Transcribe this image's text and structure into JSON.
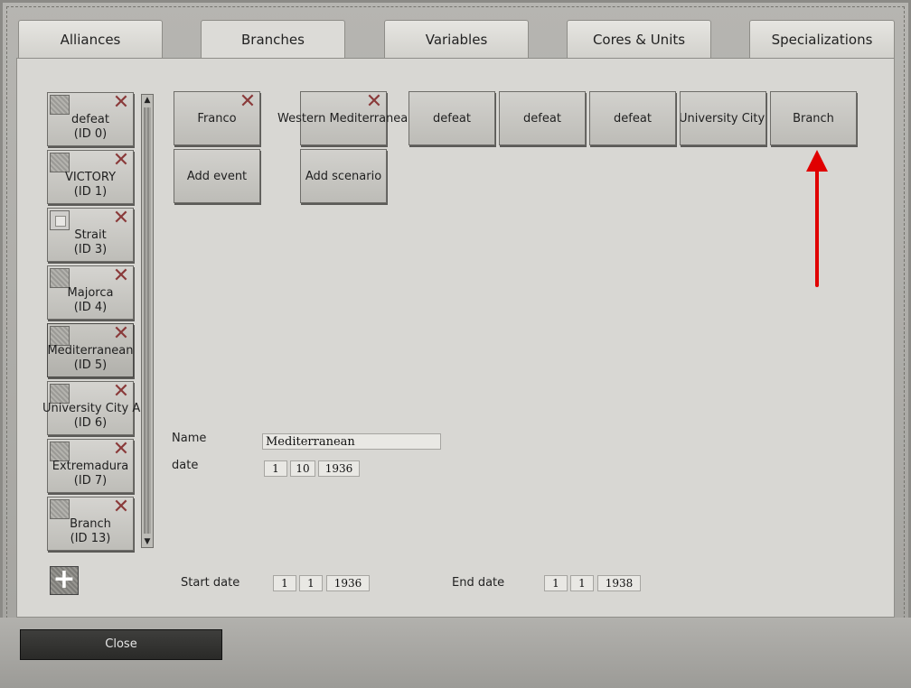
{
  "tabs": [
    {
      "label": "Alliances"
    },
    {
      "label": "Branches"
    },
    {
      "label": "Variables"
    },
    {
      "label": "Cores & Units"
    },
    {
      "label": "Specializations"
    }
  ],
  "sidebar": {
    "items": [
      {
        "label": "defeat",
        "id": "(ID 0)"
      },
      {
        "label": "VICTORY",
        "id": "(ID 1)"
      },
      {
        "label": "Strait",
        "id": "(ID 3)"
      },
      {
        "label": "Majorca",
        "id": "(ID 4)"
      },
      {
        "label": "Mediterranean",
        "id": "(ID 5)"
      },
      {
        "label": "University City A",
        "id": "(ID 6)"
      },
      {
        "label": "Extremadura",
        "id": "(ID 7)"
      },
      {
        "label": "Branch",
        "id": "(ID 13)"
      }
    ]
  },
  "grid": {
    "row1": [
      "Franco",
      "Western Mediterranean",
      "defeat",
      "defeat",
      "defeat",
      "University City B",
      "Branch"
    ],
    "row2": [
      "Add event",
      "Add scenario"
    ]
  },
  "form": {
    "name_label": "Name",
    "name_value": "Mediterranean",
    "date_label": "date",
    "date_day": "1",
    "date_month": "10",
    "date_year": "1936",
    "start_label": "Start date",
    "start_day": "1",
    "start_month": "1",
    "start_year": "1936",
    "end_label": "End date",
    "end_day": "1",
    "end_month": "1",
    "end_year": "1938"
  },
  "footer": {
    "close_label": "Close"
  },
  "colors": {
    "annotation_arrow": "#e00000"
  }
}
